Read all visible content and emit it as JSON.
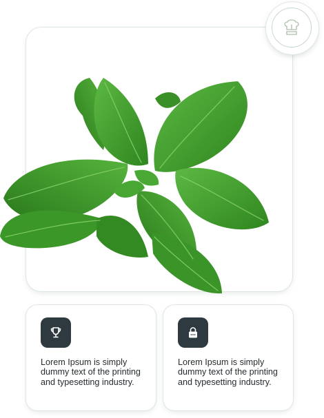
{
  "hero": {
    "image": "basil-leaves"
  },
  "badge": {
    "icon": "chef-hat-icon",
    "accent": "#b8cab9"
  },
  "features": [
    {
      "icon": "trophy-icon",
      "text": "Lorem Ipsum is simply dummy text of the printing and typesetting industry."
    },
    {
      "icon": "lock-icon",
      "text": "Lorem Ipsum is simply dummy text of the printing and typesetting industry."
    }
  ],
  "colors": {
    "icon_tile": "#2f3a40",
    "leaf": "#3f9a2c",
    "leaf_dark": "#2d7d21"
  }
}
